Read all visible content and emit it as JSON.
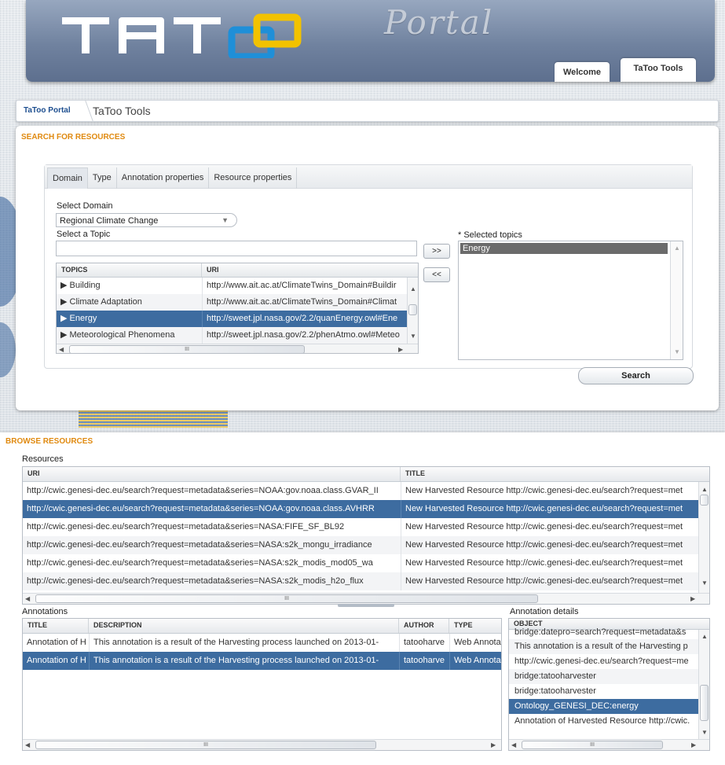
{
  "header": {
    "logo_text": "TATOO",
    "portal_text": "Portal",
    "tabs": [
      {
        "label": "Welcome",
        "active": false
      },
      {
        "label": "TaToo Tools",
        "active": true
      }
    ]
  },
  "breadcrumb": {
    "home": "TaToo Portal",
    "current": "TaToo Tools"
  },
  "search": {
    "section_title": "SEARCH FOR RESOURCES",
    "tabs": [
      "Domain",
      "Type",
      "Annotation properties",
      "Resource properties"
    ],
    "select_domain_label": "Select Domain",
    "domain_value": "Regional Climate Change",
    "select_topic_label": "Select a Topic",
    "topic_input_value": "",
    "topics_header": [
      "TOPICS",
      "URI"
    ],
    "topics": [
      {
        "topic": "▶ Building",
        "uri": "http://www.ait.ac.at/ClimateTwins_Domain#Buildir"
      },
      {
        "topic": "▶ Climate Adaptation",
        "uri": "http://www.ait.ac.at/ClimateTwins_Domain#Climat"
      },
      {
        "topic": "▶ Energy",
        "uri": "http://sweet.jpl.nasa.gov/2.2/quanEnergy.owl#Ene"
      },
      {
        "topic": "▶ Meteorological Phenomena",
        "uri": "http://sweet.jpl.nasa.gov/2.2/phenAtmo.owl#Meteo"
      }
    ],
    "selected_topic_index": 2,
    "add_button": ">>",
    "remove_button": "<<",
    "selected_topics_label": "* Selected topics",
    "selected_topics": [
      "Energy"
    ],
    "search_button": "Search",
    "scroll_marker": "III"
  },
  "browse": {
    "section_title": "BROWSE RESOURCES",
    "resources_label": "Resources",
    "resources_header": [
      "URI",
      "TITLE"
    ],
    "resources": [
      {
        "uri": "http://cwic.genesi-dec.eu/search?request=metadata&series=NOAA:gov.noaa.class.GVAR_II",
        "title": "New Harvested Resource http://cwic.genesi-dec.eu/search?request=met"
      },
      {
        "uri": "http://cwic.genesi-dec.eu/search?request=metadata&series=NOAA:gov.noaa.class.AVHRR",
        "title": "New Harvested Resource http://cwic.genesi-dec.eu/search?request=met"
      },
      {
        "uri": "http://cwic.genesi-dec.eu/search?request=metadata&series=NASA:FIFE_SF_BL92",
        "title": "New Harvested Resource http://cwic.genesi-dec.eu/search?request=met"
      },
      {
        "uri": "http://cwic.genesi-dec.eu/search?request=metadata&series=NASA:s2k_mongu_irradiance",
        "title": "New Harvested Resource http://cwic.genesi-dec.eu/search?request=met"
      },
      {
        "uri": "http://cwic.genesi-dec.eu/search?request=metadata&series=NASA:s2k_modis_mod05_wa",
        "title": "New Harvested Resource http://cwic.genesi-dec.eu/search?request=met"
      },
      {
        "uri": "http://cwic.genesi-dec.eu/search?request=metadata&series=NASA:s2k_modis_h2o_flux",
        "title": "New Harvested Resource http://cwic.genesi-dec.eu/search?request=met"
      }
    ],
    "selected_resource_index": 1,
    "annotations_label": "Annotations",
    "annotations_header": [
      "TITLE",
      "DESCRIPTION",
      "AUTHOR",
      "TYPE"
    ],
    "annotations": [
      {
        "title": "Annotation of H",
        "description": "This annotation is a result of the Harvesting process launched on 2013-01-",
        "author": "tatooharve",
        "type": "Web Annota"
      },
      {
        "title": "Annotation of H",
        "description": "This annotation is a result of the Harvesting process launched on 2013-01-",
        "author": "tatooharve",
        "type": "Web Annota"
      }
    ],
    "selected_annotation_index": 1,
    "details_label": "Annotation details",
    "details_header": "OBJECT",
    "details": [
      "bridge:datepro=search?request=metadata&s",
      "This annotation is a result of the Harvesting p",
      "http://cwic.genesi-dec.eu/search?request=me",
      "bridge:tatooharvester",
      "bridge:tatooharvester",
      "Ontology_GENESI_DEC:energy",
      "Annotation of Harvested Resource http://cwic."
    ],
    "selected_detail_index": 5
  },
  "colors": {
    "header_blue": "#70829f",
    "section_orange": "#e08a10",
    "selection_blue": "#3d6ca0",
    "logo_blue": "#1f8fd8",
    "logo_yellow": "#f2c200"
  }
}
